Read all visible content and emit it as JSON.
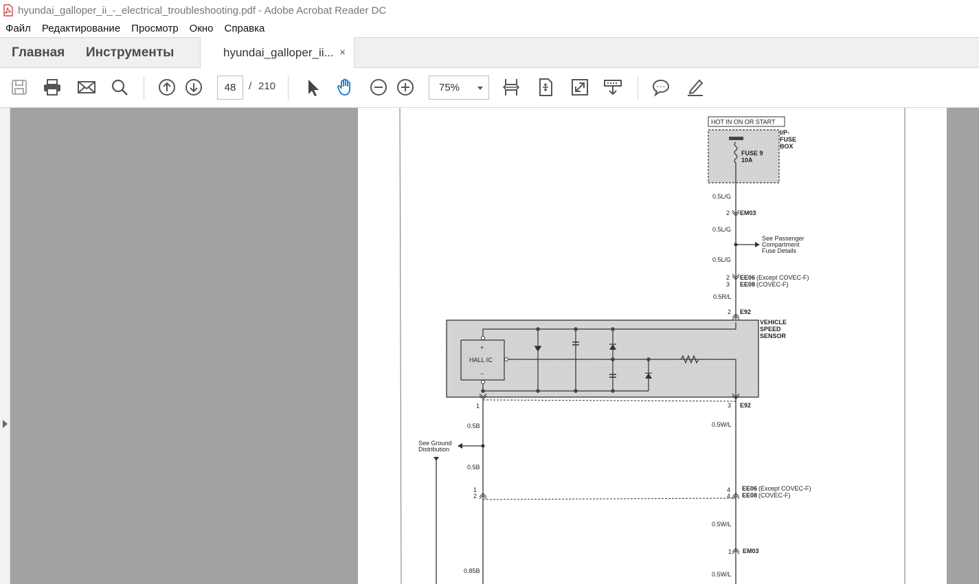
{
  "window": {
    "title": "hyundai_galloper_ii_-_electrical_troubleshooting.pdf - Adobe Acrobat Reader DC"
  },
  "menu": [
    "Файл",
    "Редактирование",
    "Просмотр",
    "Окно",
    "Справка"
  ],
  "tabs": {
    "home": "Главная",
    "tools": "Инструменты",
    "document": "hyundai_galloper_ii...",
    "close": "×"
  },
  "toolbar": {
    "page_current": "48",
    "page_separator": "/",
    "page_total": "210",
    "zoom": "75%"
  },
  "icons": [
    "save-icon",
    "print-icon",
    "email-icon",
    "search-icon",
    "page-up-icon",
    "page-down-icon",
    "select-cursor-icon",
    "hand-tool-icon",
    "zoom-out-icon",
    "zoom-in-icon",
    "fit-width-icon",
    "fit-page-icon",
    "full-screen-icon",
    "scroll-mode-icon",
    "comment-icon",
    "sign-pen-icon"
  ],
  "diagram": {
    "hot_label": "HOT IN ON OR START",
    "fuse_box_label": [
      "I/P-",
      "FUSE",
      "BOX"
    ],
    "fuse_name": "FUSE 9",
    "fuse_rating": "10A",
    "wire_lg1": "0.5L/G",
    "em03_pin": "2",
    "em03": "EM03",
    "wire_lg2": "0.5L/G",
    "passenger_ref": [
      "See Passenger",
      "Compartment",
      "Fuse Details"
    ],
    "wire_lg3": "0.5L/G",
    "ee06_pin_top": "2",
    "ee06_top": "EE06",
    "ee06_note_top": "(Except COVEC-F)",
    "ee08_pin_top": "3",
    "ee08_top": "EE08",
    "ee08_note_top": "(COVEC-F)",
    "wire_rl": "0.5R/L",
    "e92_pin_top": "2",
    "e92_top": "E92",
    "sensor_label": [
      "VEHICLE",
      "SPEED",
      "SENSOR"
    ],
    "hall_ic": "HALL IC",
    "plus": "+",
    "minus": "−",
    "e92_pin_left": "1",
    "e92_pin_right": "3",
    "e92_bottom": "E92",
    "wire_b1": "0.5B",
    "wire_wl1": "0.5W/L",
    "ground_ref": [
      "See Ground",
      "Distribution"
    ],
    "wire_b2": "0.5B",
    "ee_pin_left_1": "1",
    "ee_pin_left_2": "2",
    "ee_pin_right_1": "4",
    "ee_pin_right_2": "4",
    "ee06_bottom": "EE06",
    "ee06_note_bottom": "(Except COVEC-F)",
    "ee08_bottom": "EE08",
    "ee08_note_bottom": "(COVEC-F)",
    "wire_wl2": "0.5W/L",
    "em03_pin_bottom": "1",
    "em03_bottom": "EM03",
    "wire_b3": "0.85B",
    "wire_wl3": "0.5W/L"
  }
}
